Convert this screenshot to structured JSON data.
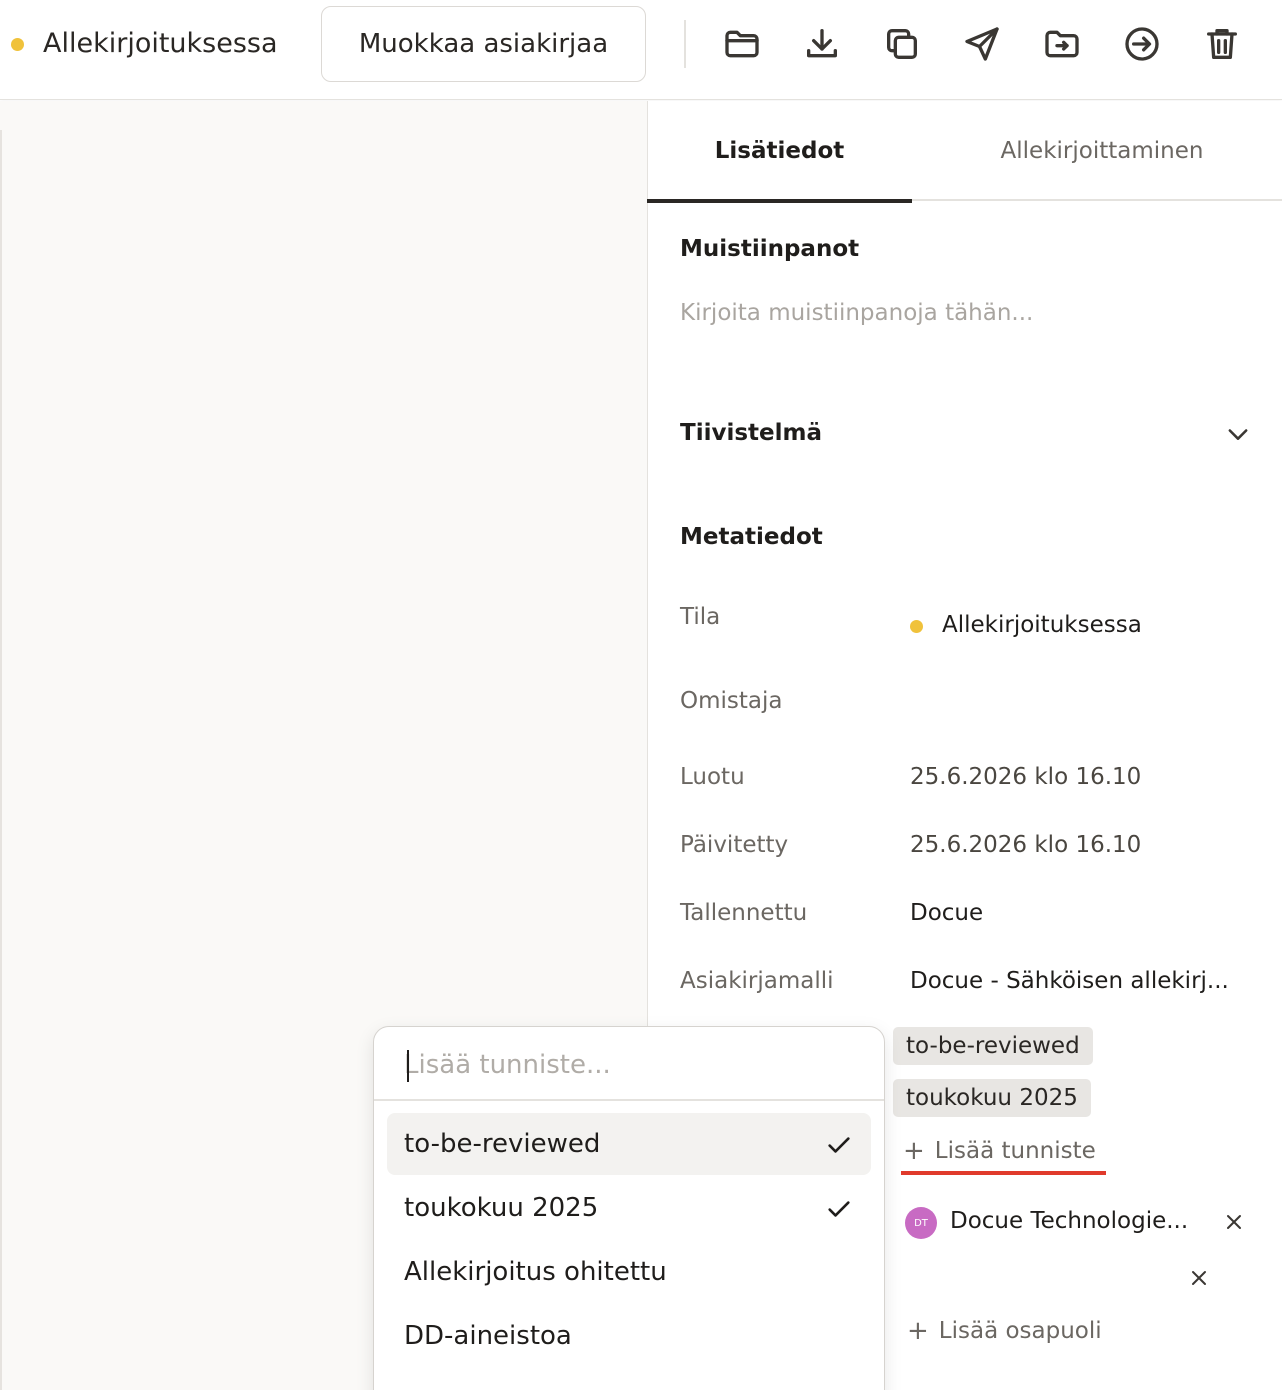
{
  "toolbar": {
    "status_label": "Allekirjoituksessa",
    "status_color": "#f0c23b",
    "edit_button": "Muokkaa asiakirjaa",
    "icons": [
      "folder-icon",
      "download-icon",
      "copy-icon",
      "send-icon",
      "move-to-folder-icon",
      "export-icon",
      "trash-icon"
    ]
  },
  "tabs": {
    "info": "Lisätiedot",
    "signing": "Allekirjoittaminen"
  },
  "notes": {
    "title": "Muistiinpanot",
    "placeholder": "Kirjoita muistiinpanoja tähän..."
  },
  "summary": {
    "title": "Tiivistelmä"
  },
  "metadata": {
    "title": "Metatiedot",
    "status_label": "Tila",
    "status_value": "Allekirjoituksessa",
    "owner_label": "Omistaja",
    "created_label": "Luotu",
    "created_value": "25.6.2026 klo 16.10",
    "updated_label": "Päivitetty",
    "updated_value": "25.6.2026 klo 16.10",
    "saved_label": "Tallennettu",
    "saved_value": "Docue",
    "template_label": "Asiakirjamalli",
    "template_value": "Docue - Sähköisen allekirj..."
  },
  "tags": {
    "items": [
      "to-be-reviewed",
      "toukokuu 2025"
    ],
    "add_label": "Lisää tunniste"
  },
  "parties": {
    "avatar_initials": "DT",
    "name": "Docue Technologie...",
    "add_label": "Lisää osapuoli"
  },
  "tag_dropdown": {
    "placeholder": "Lisää tunniste...",
    "options": [
      {
        "label": "to-be-reviewed",
        "checked": true
      },
      {
        "label": "toukokuu 2025",
        "checked": true
      },
      {
        "label": "Allekirjoitus ohitettu",
        "checked": false
      },
      {
        "label": "DD-aineistoa",
        "checked": false
      }
    ]
  }
}
